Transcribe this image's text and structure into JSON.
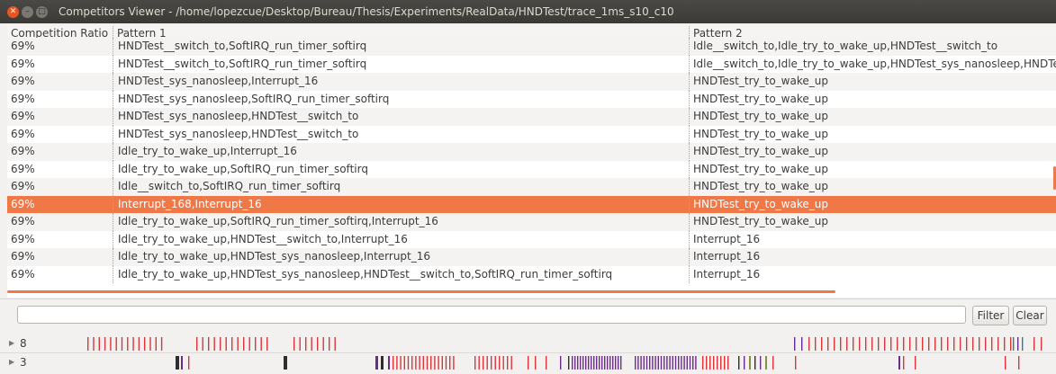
{
  "window": {
    "title": "Competitors Viewer - /home/lopezcue/Desktop/Bureau/Thesis/Experiments/RealData/HNDTest/trace_1ms_s10_c10",
    "controls": [
      "close-icon",
      "minimize-icon",
      "maximize-icon"
    ]
  },
  "table": {
    "columns": [
      "Competition Ratio",
      "Pattern 1",
      "Pattern 2"
    ],
    "selected_row": 10,
    "rows": [
      {
        "ratio": "69%",
        "pattern1": "HNDTest__switch_to,SoftIRQ_run_timer_softirq",
        "pattern2": "Idle__switch_to,Idle_try_to_wake_up,HNDTest__switch_to"
      },
      {
        "ratio": "69%",
        "pattern1": "HNDTest__switch_to,SoftIRQ_run_timer_softirq",
        "pattern2": "Idle__switch_to,Idle_try_to_wake_up,HNDTest_sys_nanosleep,HNDTes"
      },
      {
        "ratio": "69%",
        "pattern1": "HNDTest_sys_nanosleep,Interrupt_16",
        "pattern2": "HNDTest_try_to_wake_up"
      },
      {
        "ratio": "69%",
        "pattern1": "HNDTest_sys_nanosleep,SoftIRQ_run_timer_softirq",
        "pattern2": "HNDTest_try_to_wake_up"
      },
      {
        "ratio": "69%",
        "pattern1": "HNDTest_sys_nanosleep,HNDTest__switch_to",
        "pattern2": "HNDTest_try_to_wake_up"
      },
      {
        "ratio": "69%",
        "pattern1": "HNDTest_sys_nanosleep,HNDTest__switch_to",
        "pattern2": "HNDTest_try_to_wake_up"
      },
      {
        "ratio": "69%",
        "pattern1": "Idle_try_to_wake_up,Interrupt_16",
        "pattern2": "HNDTest_try_to_wake_up"
      },
      {
        "ratio": "69%",
        "pattern1": "Idle_try_to_wake_up,SoftIRQ_run_timer_softirq",
        "pattern2": "HNDTest_try_to_wake_up"
      },
      {
        "ratio": "69%",
        "pattern1": "Idle__switch_to,SoftIRQ_run_timer_softirq",
        "pattern2": "HNDTest_try_to_wake_up"
      },
      {
        "ratio": "69%",
        "pattern1": "Interrupt_168,Interrupt_16",
        "pattern2": "HNDTest_try_to_wake_up"
      },
      {
        "ratio": "69%",
        "pattern1": "Idle_try_to_wake_up,SoftIRQ_run_timer_softirq,Interrupt_16",
        "pattern2": "HNDTest_try_to_wake_up"
      },
      {
        "ratio": "69%",
        "pattern1": "Idle_try_to_wake_up,HNDTest__switch_to,Interrupt_16",
        "pattern2": "Interrupt_16"
      },
      {
        "ratio": "69%",
        "pattern1": "Idle_try_to_wake_up,HNDTest_sys_nanosleep,Interrupt_16",
        "pattern2": "Interrupt_16"
      },
      {
        "ratio": "69%",
        "pattern1": "Idle_try_to_wake_up,HNDTest_sys_nanosleep,HNDTest__switch_to,SoftIRQ_run_timer_softirq",
        "pattern2": "Interrupt_16"
      }
    ]
  },
  "filter": {
    "value": "",
    "filter_label": "Filter",
    "clear_label": "Clear"
  },
  "tracks": [
    {
      "label": "8",
      "icon": "expand-arrow-icon"
    },
    {
      "label": "3",
      "icon": "expand-arrow-icon"
    }
  ],
  "colors": {
    "accent": "#f07746",
    "close": "#e95420",
    "track_red": "#d9363a",
    "track_purple": "#6b2c8a",
    "track_dark": "#2e2e2e",
    "track_olive": "#8a8f3a",
    "track_teal": "#2a7f8a"
  }
}
